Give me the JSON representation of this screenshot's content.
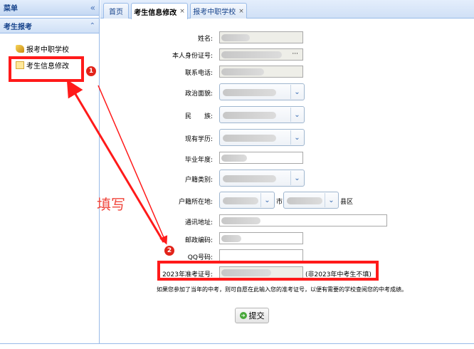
{
  "sidebar": {
    "title": "菜单",
    "collapse_icon": "double-chevron-left-icon",
    "section_title": "考生报考",
    "section_icon": "double-chevron-up-icon",
    "items": [
      {
        "label": "报考中职学校",
        "icon": "bell-icon"
      },
      {
        "label": "考生信息修改",
        "icon": "note-icon"
      }
    ]
  },
  "tabs": [
    {
      "label": "首页",
      "closable": false
    },
    {
      "label": "考生信息修改",
      "closable": true,
      "active": true
    },
    {
      "label": "报考中职学校",
      "closable": true
    }
  ],
  "tab_close_glyph": "×",
  "form": {
    "name_label": "姓名:",
    "id_label": "本人身份证号:",
    "id_visible_tail": "···",
    "phone_label": "联系电话:",
    "political_label": "政治面貌:",
    "ethnicity_label": "民　　族:",
    "education_label": "现有学历:",
    "grad_year_label": "毕业年度:",
    "hukou_type_label": "户籍类别:",
    "hukou_loc_label": "户籍所在地:",
    "city_suffix": "市",
    "district_suffix": "县区",
    "address_label": "通讯地址:",
    "postcode_label": "邮政编码:",
    "qq_label": "QQ号码:",
    "exam_no_label": "2023年准考证号:",
    "exam_no_hint": "(非2023年中考生不填)",
    "note": "如果您参加了当年的中考，则可自愿在此输入您的准考证号，以便有需要的学校查阅您的中考成绩。",
    "submit_label": "提交"
  },
  "annotations": {
    "fill_text": "填写",
    "badge_1": "1",
    "badge_2": "2",
    "color": "#ff1a1a"
  }
}
